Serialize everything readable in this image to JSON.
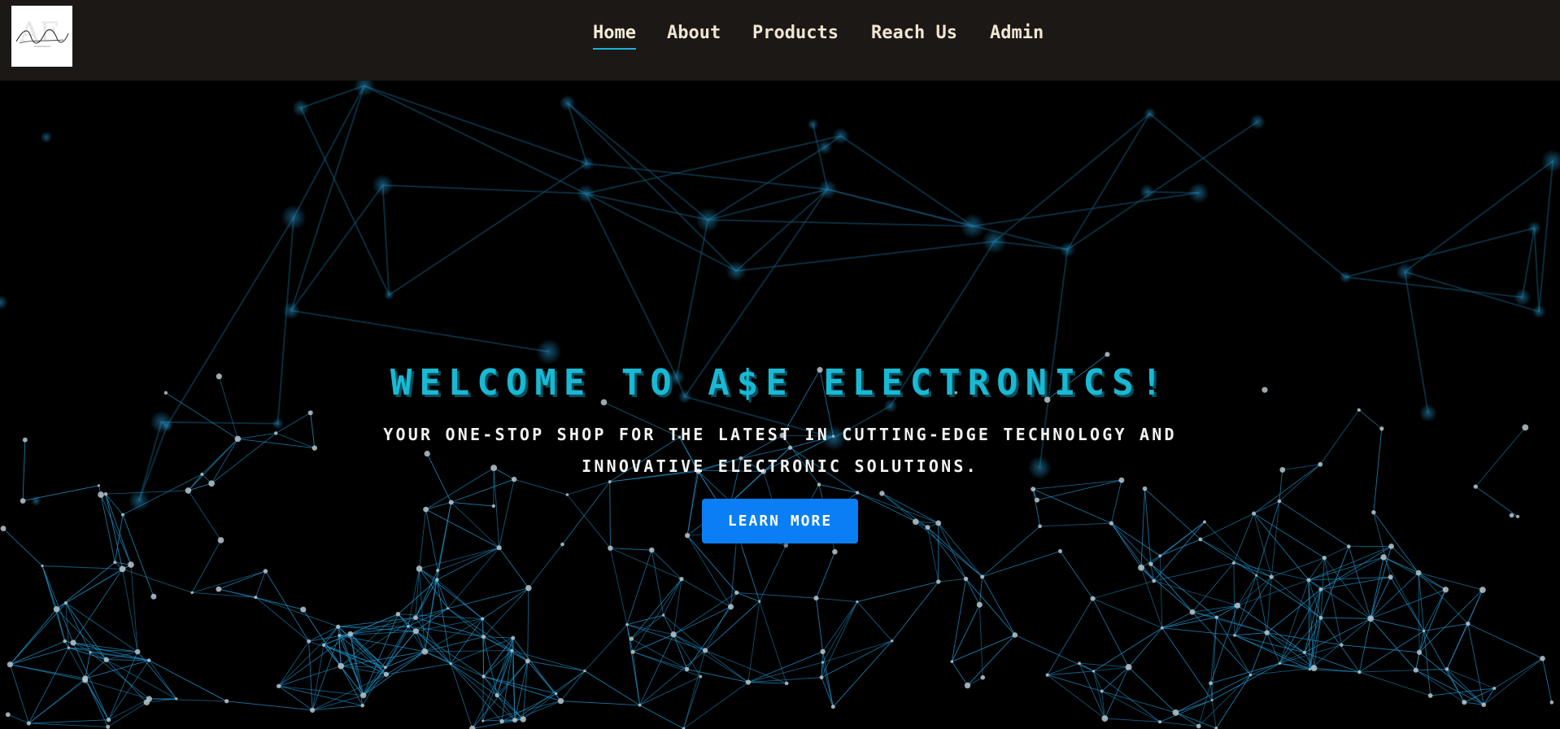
{
  "logo": {
    "alt": "A&E Electronics logo",
    "script_text": "Adam & Erica",
    "monogram": "AE"
  },
  "nav": {
    "items": [
      {
        "label": "Home",
        "active": true
      },
      {
        "label": "About",
        "active": false
      },
      {
        "label": "Products",
        "active": false
      },
      {
        "label": "Reach Us",
        "active": false
      },
      {
        "label": "Admin",
        "active": false
      }
    ]
  },
  "hero": {
    "title": "WELCOME TO A$E ELECTRONICS!",
    "subtitle": "YOUR ONE-STOP SHOP FOR THE LATEST IN CUTTING-EDGE TECHNOLOGY AND INNOVATIVE ELECTRONIC SOLUTIONS.",
    "cta_label": "LEARN MORE",
    "background": "plexus-network-illustration"
  },
  "colors": {
    "navbar_bg": "#1c1816",
    "nav_text": "#efe6d2",
    "nav_active_underline": "#1ab2d8",
    "hero_bg": "#000000",
    "title": "#19b9d4",
    "subtitle": "#f2f2f2",
    "button_bg": "#0a7ff5",
    "network_line": "#1e8fc4",
    "network_node": "#b8c6cc"
  }
}
